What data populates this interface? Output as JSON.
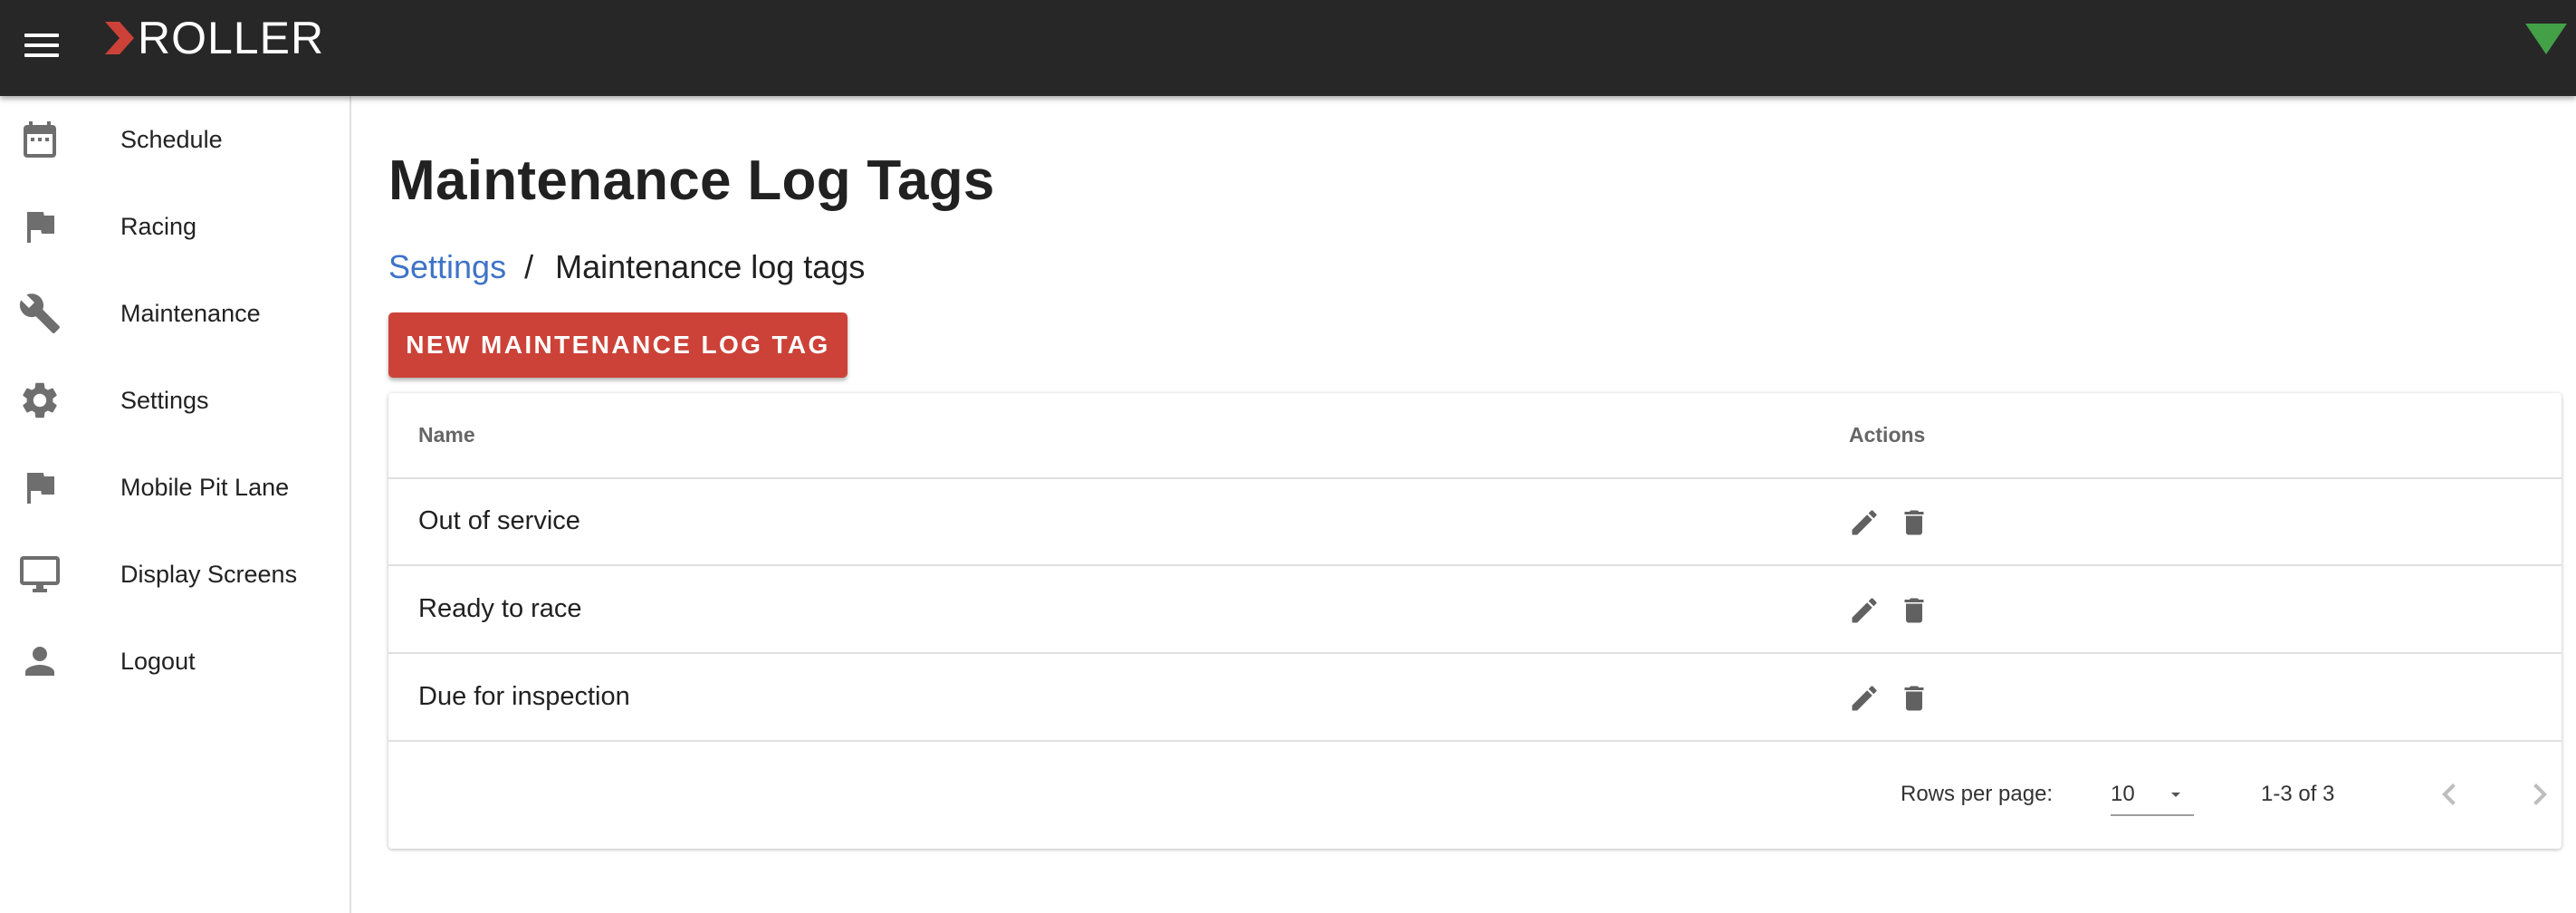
{
  "app": {
    "brand": "ROLLER",
    "brand_color": "#cc4238",
    "status_color": "#43a047"
  },
  "header": {
    "menu_icon": "hamburger-menu-icon",
    "status_icon": "wifi-signal-icon"
  },
  "sidebar": {
    "items": [
      {
        "label": "Schedule",
        "icon": "calendar-icon"
      },
      {
        "label": "Racing",
        "icon": "flag-icon"
      },
      {
        "label": "Maintenance",
        "icon": "wrench-icon"
      },
      {
        "label": "Settings",
        "icon": "gear-icon"
      },
      {
        "label": "Mobile Pit Lane",
        "icon": "flag-icon"
      },
      {
        "label": "Display Screens",
        "icon": "monitor-icon"
      },
      {
        "label": "Logout",
        "icon": "person-icon"
      }
    ]
  },
  "page": {
    "title": "Maintenance Log Tags",
    "breadcrumb": {
      "parent": "Settings",
      "separator": "/",
      "current": "Maintenance log tags"
    },
    "new_button": "NEW MAINTENANCE LOG TAG"
  },
  "table": {
    "columns": [
      "Name",
      "Actions"
    ],
    "rows": [
      {
        "name": "Out of service"
      },
      {
        "name": "Ready to race"
      },
      {
        "name": "Due for inspection"
      }
    ],
    "row_actions": [
      "pencil-icon",
      "trash-icon"
    ],
    "pagination": {
      "rows_per_page_label": "Rows per page:",
      "rows_per_page": "10",
      "range": "1-3 of 3"
    }
  }
}
